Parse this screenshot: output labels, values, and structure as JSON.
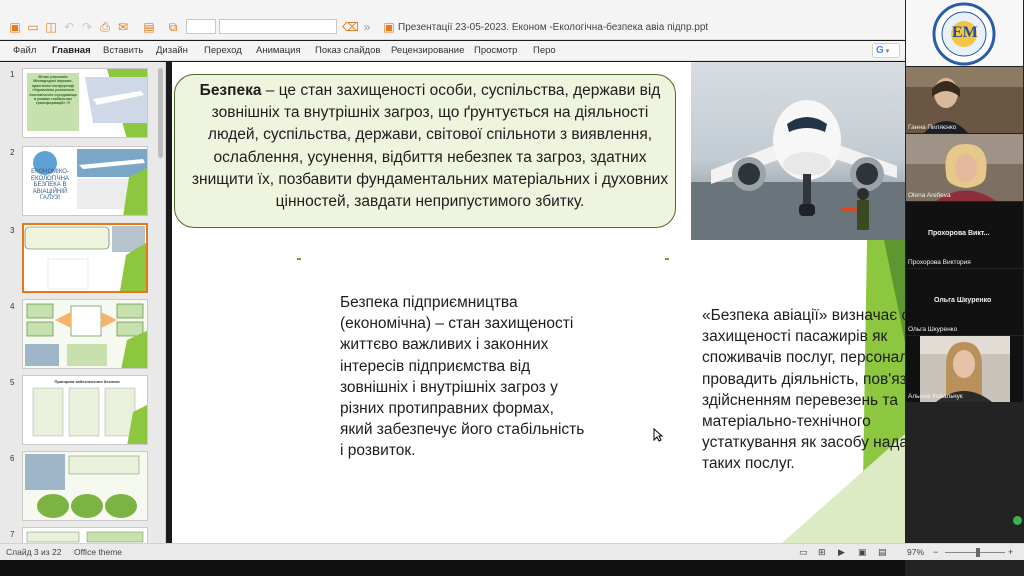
{
  "window": {
    "title": "Презентації 23-05-2023. Економ -Екологічна-безпека авіа підпр.ppt",
    "quick_access": [
      "new-icon",
      "open-icon",
      "save-icon",
      "undo-icon",
      "redo-icon",
      "print-icon",
      "email-icon",
      "layout-icon",
      "copy-icon"
    ]
  },
  "ribbon": {
    "tabs": [
      "Файл",
      "Главная",
      "Вставить",
      "Дизайн",
      "Переход",
      "Анимация",
      "Показ слайдов",
      "Рецензирование",
      "Просмотр",
      "Перо"
    ],
    "active_tab": "Главная",
    "search_chip": "G"
  },
  "thumbnails": {
    "items": [
      {
        "number": "1",
        "caption": "Вітаю учасників Міжнародної науково-практичної конференції «Управління розвитком економічного середовища в умовах глобальних трансформацій» !!!"
      },
      {
        "number": "2",
        "caption": "ЕКОНОМІКО-ЕКОЛОГІЧНА БЕЗПЕКА В АВІАЦІЙНІЙ ГАЛУЗІ"
      },
      {
        "number": "3"
      },
      {
        "number": "4"
      },
      {
        "number": "5",
        "caption": "Принципи забезпечення безпеки"
      },
      {
        "number": "6"
      },
      {
        "number": "7"
      }
    ],
    "active_index": 2
  },
  "slide": {
    "callout": {
      "term": "Безпека",
      "text": " – це стан захищеності особи, суспільства, держави від зовнішніх та внутрішніх загроз, що ґрунтується на діяльності людей, суспільства, держави, світової спільноти з виявлення, ослаблення, усунення, відбиття небезпек та загроз, здатних знищити їх, позбавити фундаментальних матеріальних і духовних цінностей, завдати неприпустимого збитку."
    },
    "left_block": {
      "term": "Безпека підприємництва (економічна)",
      "text": " – стан захищеності життєво важливих і законних інтересів підприємства від зовнішніх і внутрішніх загроз у різних протиправних формах, який забезпечує його стабільність і розвиток."
    },
    "right_block": {
      "term": "«Безпека авіації»",
      "text": " визначає стан захищеності пасажирів як споживачів послуг, персоналу, що провадить діяльність, пов'язану зі здійсненням перевезень та матеріально-технічного устаткування як засобу надання таких послуг."
    },
    "colors": {
      "green_light": "#8dc63f",
      "green_dark": "#4a7a2a",
      "callout_fill": "#eef4dd"
    }
  },
  "participants": [
    {
      "name": "logo",
      "label": "EM"
    },
    {
      "name": "Ганна Пиляєнко"
    },
    {
      "name": "Olena Arefieva"
    },
    {
      "name": "Прохорова Викт...",
      "subtitle": "Прохорова Виктория"
    },
    {
      "name": "Ольга Шкуренко",
      "subtitle": "Ольга Шкуренко"
    },
    {
      "name": "Альона Ковальчук"
    }
  ],
  "statusbar": {
    "slide_info": "Слайд 3 из 22",
    "theme": "Office theme",
    "zoom": "97%",
    "zoom_level": 0.55
  }
}
